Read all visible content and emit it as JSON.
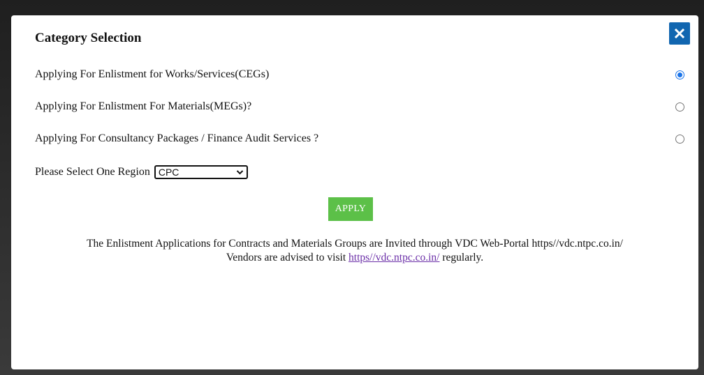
{
  "modal": {
    "title": "Category Selection",
    "close_icon": "close-icon"
  },
  "options": [
    {
      "label": "Applying For Enlistment for Works/Services(CEGs)",
      "checked": true
    },
    {
      "label": "Applying For Enlistment For Materials(MEGs)?",
      "checked": false
    },
    {
      "label": "Applying For Consultancy Packages / Finance Audit Services ?",
      "checked": false
    }
  ],
  "region": {
    "label": "Please Select One Region",
    "selected": "CPC"
  },
  "apply_label": "APPLY",
  "notice": {
    "line1": "The Enlistment Applications for Contracts and Materials Groups are Invited through VDC Web-Portal https//vdc.ntpc.co.in/",
    "line2_prefix": "Vendors are advised to visit ",
    "link_text": "https//vdc.ntpc.co.in/",
    "line2_suffix": " regularly."
  },
  "colors": {
    "close_bg": "#1166b0",
    "apply_bg": "#5cc048",
    "radio_accent": "#1a73e8",
    "link": "#6b2fa8"
  }
}
